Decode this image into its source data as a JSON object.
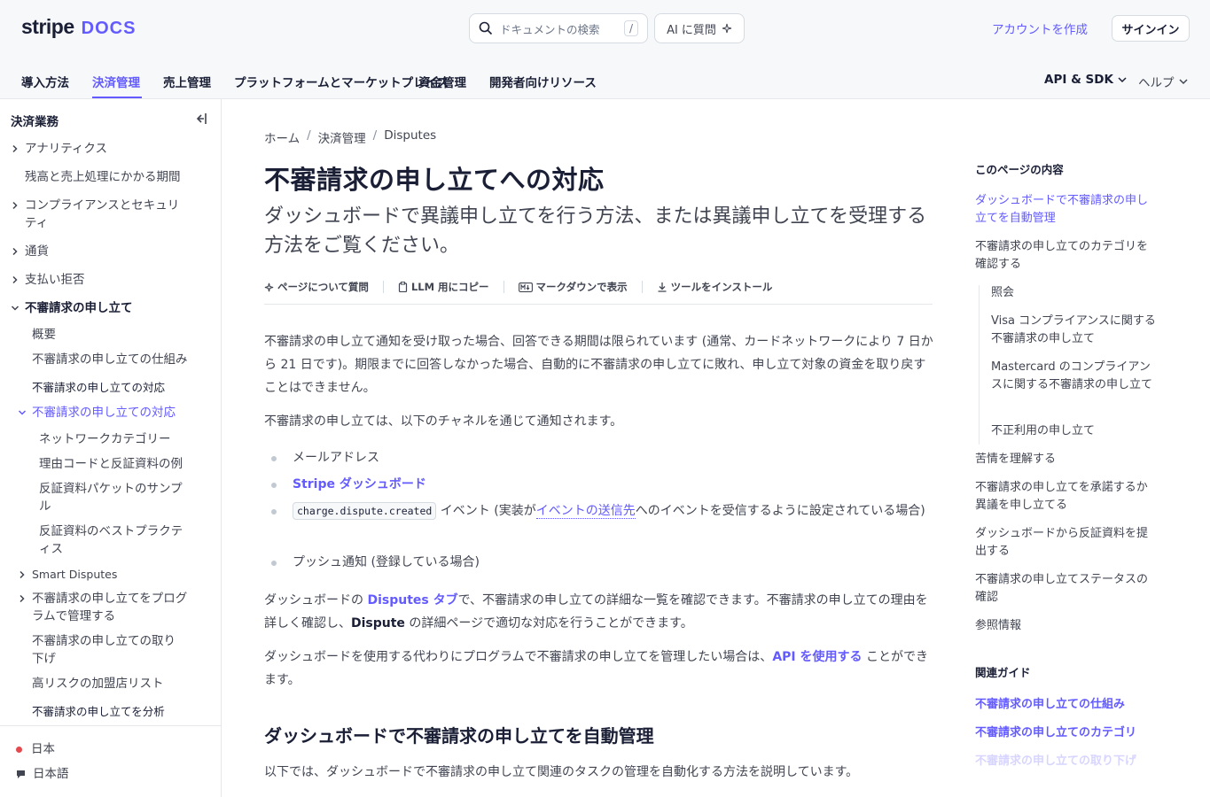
{
  "header": {
    "logo_stripe": "stripe",
    "logo_docs": "DOCS",
    "search_placeholder": "ドキュメントの検索",
    "search_shortcut": "/",
    "ask_ai": "AI に質問",
    "create_account": "アカウントを作成",
    "sign_in": "サインイン"
  },
  "nav": {
    "items": [
      "導入方法",
      "決済管理",
      "売上管理",
      "プラットフォームとマーケットプレイス",
      "資金管理",
      "開発者向けリソース"
    ],
    "active_index": 1,
    "api_sdk": "API & SDK",
    "help": "ヘルプ"
  },
  "sidebar": {
    "heading": "決済業務",
    "items": [
      {
        "label": "アナリティクス",
        "chevron": "right"
      },
      {
        "label": "残高と売上処理にかかる期間",
        "chevron": ""
      },
      {
        "label": "コンプライアンスとセキュリティ",
        "chevron": "right"
      },
      {
        "label": "通貨",
        "chevron": "right"
      },
      {
        "label": "支払い拒否",
        "chevron": "right"
      },
      {
        "label": "不審請求の申し立て",
        "chevron": "down"
      },
      {
        "label": "概要",
        "chevron": ""
      },
      {
        "label": "不審請求の申し立ての仕組み",
        "chevron": ""
      },
      {
        "label": "不審請求の申し立ての対応",
        "chevron": ""
      },
      {
        "label": "不審請求の申し立ての対応",
        "chevron": "down"
      },
      {
        "label": "ネットワークカテゴリー",
        "chevron": ""
      },
      {
        "label": "理由コードと反証資料の例",
        "chevron": ""
      },
      {
        "label": "反証資料パケットのサンプル",
        "chevron": ""
      },
      {
        "label": "反証資料のベストプラクティス",
        "chevron": ""
      },
      {
        "label": "Smart Disputes",
        "chevron": "right"
      },
      {
        "label": "不審請求の申し立てをプログラムで管理する",
        "chevron": "right"
      },
      {
        "label": "不審請求の申し立ての取り下げ",
        "chevron": ""
      },
      {
        "label": "高リスクの加盟店リスト",
        "chevron": ""
      },
      {
        "label": "不審請求の申し立てを分析",
        "chevron": ""
      }
    ],
    "country": "日本",
    "language": "日本語"
  },
  "breadcrumb": [
    "ホーム",
    "決済管理",
    "Disputes"
  ],
  "page": {
    "title": "不審請求の申し立てへの対応",
    "subtitle": "ダッシュボードで異議申し立てを行う方法、または異議申し立てを受理する方法をご覧ください。",
    "actions": [
      "ページについて質問",
      "LLM 用にコピー",
      "マークダウンで表示",
      "ツールをインストール"
    ],
    "p1": "不審請求の申し立て通知を受け取った場合、回答できる期間は限られています (通常、カードネットワークにより 7 日から 21 日です)。期限までに回答しなかった場合、自動的に不審請求の申し立てに敗れ、申し立て対象の資金を取り戻すことはできません。",
    "p2": "不審請求の申し立ては、以下のチャネルを通じて通知されます。",
    "bullets": {
      "b1": "メールアドレス",
      "b2": "Stripe ダッシュボード",
      "b3_code": "charge.dispute.created",
      "b3_a": " イベント (実装が",
      "b3_link": "イベントの送信先",
      "b3_b": "へのイベントを受信するように設定されている場合)",
      "b4": "プッシュ通知 (登録している場合)"
    },
    "p3_a": "ダッシュボードの ",
    "p3_link": "Disputes タブ",
    "p3_b": "で、不審請求の申し立ての詳細な一覧を確認できます。不審請求の申し立ての理由を詳しく確認し、",
    "p3_bold": "Dispute",
    "p3_c": " の詳細ページで適切な対応を行うことができます。",
    "p4_a": "ダッシュボードを使用する代わりにプログラムで不審請求の申し立てを管理したい場合は、",
    "p4_link": "API を使用する",
    "p4_b": " ことができます。",
    "h2": "ダッシュボードで不審請求の申し立てを自動管理",
    "p5": "以下では、ダッシュボードで不審請求の申し立て関連のタスクの管理を自動化する方法を説明しています。"
  },
  "toc": {
    "heading": "このページの内容",
    "items": [
      "ダッシュボードで不審請求の申し立てを自動管理",
      "不審請求の申し立てのカテゴリを確認する",
      "照会",
      "Visa コンプライアンスに関する不審請求の申し立て",
      "Mastercard のコンプライアンスに関する不審請求の申し立て",
      "不正利用の申し立て",
      "苦情を理解する",
      "不審請求の申し立てを承諾するか異議を申し立てる",
      "ダッシュボードから反証資料を提出する",
      "不審請求の申し立てステータスの確認",
      "参照情報"
    ]
  },
  "related": {
    "heading": "関連ガイド",
    "items": [
      "不審請求の申し立ての仕組み",
      "不審請求の申し立てのカテゴリ",
      "不審請求の申し立ての取り下げ"
    ]
  },
  "colors": {
    "accent": "#635bff",
    "text": "#414552",
    "heading": "#1a1f36",
    "header_bg": "#f6f8fa"
  }
}
